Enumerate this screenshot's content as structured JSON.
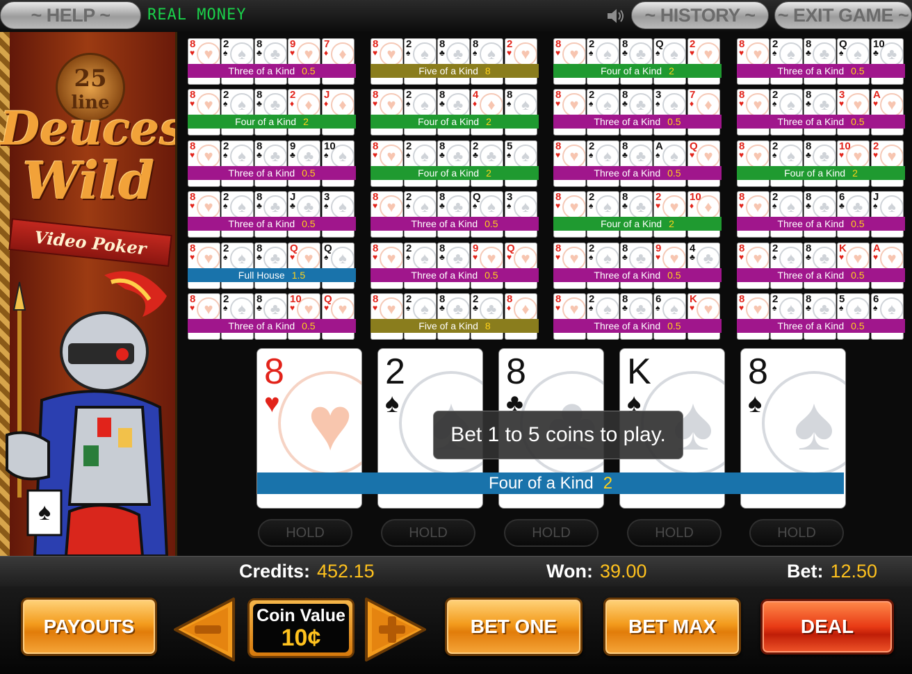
{
  "topbar": {
    "help_label": "~ HELP ~",
    "mode_label": "REAL MONEY",
    "history_label": "~ HISTORY ~",
    "exit_label": "~ EXIT GAME ~"
  },
  "banner": {
    "lines": "25",
    "line_word": "line",
    "title1": "Deuces",
    "title2": "Wild",
    "subtitle": "Video Poker"
  },
  "hand_grid": [
    [
      {
        "cards": [
          [
            "8",
            "h"
          ],
          [
            "2",
            "s"
          ],
          [
            "8",
            "c"
          ],
          [
            "9",
            "h"
          ],
          [
            "7",
            "d"
          ]
        ],
        "hand": "Three of a Kind",
        "pay": "0.5",
        "color": "#a0168c"
      },
      {
        "cards": [
          [
            "8",
            "h"
          ],
          [
            "2",
            "s"
          ],
          [
            "8",
            "c"
          ],
          [
            "2",
            "d"
          ],
          [
            "J",
            "d"
          ]
        ],
        "hand": "Four of a Kind",
        "pay": "2",
        "color": "#1f9a30"
      },
      {
        "cards": [
          [
            "8",
            "h"
          ],
          [
            "2",
            "s"
          ],
          [
            "8",
            "c"
          ],
          [
            "9",
            "c"
          ],
          [
            "10",
            "s"
          ]
        ],
        "hand": "Three of a Kind",
        "pay": "0.5",
        "color": "#a0168c"
      },
      {
        "cards": [
          [
            "8",
            "h"
          ],
          [
            "2",
            "s"
          ],
          [
            "8",
            "c"
          ],
          [
            "J",
            "c"
          ],
          [
            "3",
            "s"
          ]
        ],
        "hand": "Three of a Kind",
        "pay": "0.5",
        "color": "#a0168c"
      },
      {
        "cards": [
          [
            "8",
            "h"
          ],
          [
            "2",
            "s"
          ],
          [
            "8",
            "c"
          ],
          [
            "Q",
            "h"
          ],
          [
            "Q",
            "s"
          ]
        ],
        "hand": "Full House",
        "pay": "1.5",
        "color": "#1973ab"
      },
      {
        "cards": [
          [
            "8",
            "h"
          ],
          [
            "2",
            "s"
          ],
          [
            "8",
            "c"
          ],
          [
            "10",
            "h"
          ],
          [
            "Q",
            "h"
          ]
        ],
        "hand": "Three of a Kind",
        "pay": "0.5",
        "color": "#a0168c"
      }
    ],
    [
      {
        "cards": [
          [
            "8",
            "h"
          ],
          [
            "2",
            "s"
          ],
          [
            "8",
            "c"
          ],
          [
            "8",
            "s"
          ],
          [
            "2",
            "h"
          ]
        ],
        "hand": "Five of a Kind",
        "pay": "8",
        "color": "#8a7d1d"
      },
      {
        "cards": [
          [
            "8",
            "h"
          ],
          [
            "2",
            "s"
          ],
          [
            "8",
            "c"
          ],
          [
            "4",
            "d"
          ],
          [
            "8",
            "s"
          ]
        ],
        "hand": "Four of a Kind",
        "pay": "2",
        "color": "#1f9a30"
      },
      {
        "cards": [
          [
            "8",
            "h"
          ],
          [
            "2",
            "s"
          ],
          [
            "8",
            "c"
          ],
          [
            "2",
            "c"
          ],
          [
            "5",
            "s"
          ]
        ],
        "hand": "Four of a Kind",
        "pay": "2",
        "color": "#1f9a30"
      },
      {
        "cards": [
          [
            "8",
            "h"
          ],
          [
            "2",
            "s"
          ],
          [
            "8",
            "c"
          ],
          [
            "Q",
            "s"
          ],
          [
            "3",
            "s"
          ]
        ],
        "hand": "Three of a Kind",
        "pay": "0.5",
        "color": "#a0168c"
      },
      {
        "cards": [
          [
            "8",
            "h"
          ],
          [
            "2",
            "s"
          ],
          [
            "8",
            "c"
          ],
          [
            "9",
            "h"
          ],
          [
            "Q",
            "h"
          ]
        ],
        "hand": "Three of a Kind",
        "pay": "0.5",
        "color": "#a0168c"
      },
      {
        "cards": [
          [
            "8",
            "h"
          ],
          [
            "2",
            "s"
          ],
          [
            "8",
            "c"
          ],
          [
            "2",
            "c"
          ],
          [
            "8",
            "d"
          ]
        ],
        "hand": "Five of a Kind",
        "pay": "8",
        "color": "#8a7d1d"
      }
    ],
    [
      {
        "cards": [
          [
            "8",
            "h"
          ],
          [
            "2",
            "s"
          ],
          [
            "8",
            "c"
          ],
          [
            "Q",
            "s"
          ],
          [
            "2",
            "h"
          ]
        ],
        "hand": "Four of a Kind",
        "pay": "2",
        "color": "#1f9a30"
      },
      {
        "cards": [
          [
            "8",
            "h"
          ],
          [
            "2",
            "s"
          ],
          [
            "8",
            "c"
          ],
          [
            "3",
            "s"
          ],
          [
            "7",
            "d"
          ]
        ],
        "hand": "Three of a Kind",
        "pay": "0.5",
        "color": "#a0168c"
      },
      {
        "cards": [
          [
            "8",
            "h"
          ],
          [
            "2",
            "s"
          ],
          [
            "8",
            "c"
          ],
          [
            "A",
            "s"
          ],
          [
            "Q",
            "h"
          ]
        ],
        "hand": "Three of a Kind",
        "pay": "0.5",
        "color": "#a0168c"
      },
      {
        "cards": [
          [
            "8",
            "h"
          ],
          [
            "2",
            "s"
          ],
          [
            "8",
            "c"
          ],
          [
            "2",
            "h"
          ],
          [
            "10",
            "d"
          ]
        ],
        "hand": "Four of a Kind",
        "pay": "2",
        "color": "#1f9a30"
      },
      {
        "cards": [
          [
            "8",
            "h"
          ],
          [
            "2",
            "s"
          ],
          [
            "8",
            "c"
          ],
          [
            "9",
            "h"
          ],
          [
            "4",
            "c"
          ]
        ],
        "hand": "Three of a Kind",
        "pay": "0.5",
        "color": "#a0168c"
      },
      {
        "cards": [
          [
            "8",
            "h"
          ],
          [
            "2",
            "s"
          ],
          [
            "8",
            "c"
          ],
          [
            "6",
            "s"
          ],
          [
            "K",
            "h"
          ]
        ],
        "hand": "Three of a Kind",
        "pay": "0.5",
        "color": "#a0168c"
      }
    ],
    [
      {
        "cards": [
          [
            "8",
            "h"
          ],
          [
            "2",
            "s"
          ],
          [
            "8",
            "c"
          ],
          [
            "Q",
            "s"
          ],
          [
            "10",
            "c"
          ]
        ],
        "hand": "Three of a Kind",
        "pay": "0.5",
        "color": "#a0168c"
      },
      {
        "cards": [
          [
            "8",
            "h"
          ],
          [
            "2",
            "s"
          ],
          [
            "8",
            "c"
          ],
          [
            "3",
            "h"
          ],
          [
            "A",
            "h"
          ]
        ],
        "hand": "Three of a Kind",
        "pay": "0.5",
        "color": "#a0168c"
      },
      {
        "cards": [
          [
            "8",
            "h"
          ],
          [
            "2",
            "s"
          ],
          [
            "8",
            "c"
          ],
          [
            "10",
            "h"
          ],
          [
            "2",
            "h"
          ]
        ],
        "hand": "Four of a Kind",
        "pay": "2",
        "color": "#1f9a30"
      },
      {
        "cards": [
          [
            "8",
            "h"
          ],
          [
            "2",
            "s"
          ],
          [
            "8",
            "c"
          ],
          [
            "6",
            "c"
          ],
          [
            "J",
            "s"
          ]
        ],
        "hand": "Three of a Kind",
        "pay": "0.5",
        "color": "#a0168c"
      },
      {
        "cards": [
          [
            "8",
            "h"
          ],
          [
            "2",
            "s"
          ],
          [
            "8",
            "c"
          ],
          [
            "K",
            "h"
          ],
          [
            "A",
            "h"
          ]
        ],
        "hand": "Three of a Kind",
        "pay": "0.5",
        "color": "#a0168c"
      },
      {
        "cards": [
          [
            "8",
            "h"
          ],
          [
            "2",
            "s"
          ],
          [
            "8",
            "c"
          ],
          [
            "5",
            "s"
          ],
          [
            "6",
            "s"
          ]
        ],
        "hand": "Three of a Kind",
        "pay": "0.5",
        "color": "#a0168c"
      }
    ]
  ],
  "main_hand": {
    "cards": [
      [
        "8",
        "h"
      ],
      [
        "2",
        "s"
      ],
      [
        "8",
        "c"
      ],
      [
        "K",
        "s"
      ],
      [
        "8",
        "s"
      ]
    ],
    "hand": "Four of a Kind",
    "pay": "2",
    "color": "#1973ab",
    "hold_label": "HOLD"
  },
  "tooltip": "Bet 1 to 5 coins to play.",
  "status": {
    "credits_label": "Credits:",
    "credits_value": "452.15",
    "won_label": "Won:",
    "won_value": "39.00",
    "bet_label": "Bet:",
    "bet_value": "12.50"
  },
  "controls": {
    "payouts_label": "PAYOUTS",
    "coin_value_label": "Coin Value",
    "coin_value": "10¢",
    "bet_one_label": "BET ONE",
    "bet_max_label": "BET MAX",
    "deal_label": "DEAL"
  },
  "icons": {
    "sound": "speaker-icon",
    "minus": "minus-arrow-icon",
    "plus": "plus-arrow-icon"
  },
  "colors": {
    "accent_gold": "#ffc21e",
    "mode_green": "#1bd14a"
  }
}
